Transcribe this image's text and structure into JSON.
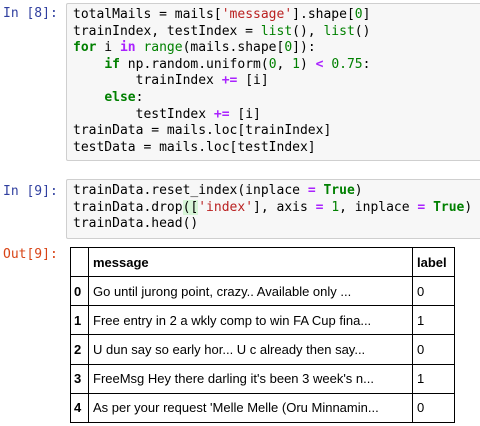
{
  "cells": {
    "in8": {
      "prompt": "In [8]:",
      "lines": [
        [
          {
            "t": "totalMails = mails["
          },
          {
            "t": "'message'",
            "c": "str"
          },
          {
            "t": "].shape["
          },
          {
            "t": "0",
            "c": "num"
          },
          {
            "t": "]"
          }
        ],
        [
          {
            "t": "trainIndex, testIndex = "
          },
          {
            "t": "list",
            "c": "bi"
          },
          {
            "t": "(), "
          },
          {
            "t": "list",
            "c": "bi"
          },
          {
            "t": "()"
          }
        ],
        [
          {
            "t": "for",
            "c": "kw"
          },
          {
            "t": " i "
          },
          {
            "t": "in",
            "c": "op"
          },
          {
            "t": " "
          },
          {
            "t": "range",
            "c": "bi"
          },
          {
            "t": "(mails.shape["
          },
          {
            "t": "0",
            "c": "num"
          },
          {
            "t": "]):"
          }
        ],
        [
          {
            "t": "    "
          },
          {
            "t": "if",
            "c": "kw"
          },
          {
            "t": " np.random.uniform("
          },
          {
            "t": "0",
            "c": "num"
          },
          {
            "t": ", "
          },
          {
            "t": "1",
            "c": "num"
          },
          {
            "t": ") "
          },
          {
            "t": "<",
            "c": "op"
          },
          {
            "t": " "
          },
          {
            "t": "0.75",
            "c": "num"
          },
          {
            "t": ":"
          }
        ],
        [
          {
            "t": "        trainIndex "
          },
          {
            "t": "+=",
            "c": "op"
          },
          {
            "t": " [i]"
          }
        ],
        [
          {
            "t": "    "
          },
          {
            "t": "else",
            "c": "kw"
          },
          {
            "t": ":"
          }
        ],
        [
          {
            "t": "        testIndex "
          },
          {
            "t": "+=",
            "c": "op"
          },
          {
            "t": " [i]"
          }
        ],
        [
          {
            "t": "trainData = mails.loc[trainIndex]"
          }
        ],
        [
          {
            "t": "testData = mails.loc[testIndex]"
          }
        ]
      ]
    },
    "in9": {
      "prompt": "In [9]:",
      "lines": [
        [
          {
            "t": "trainData.reset_index(inplace "
          },
          {
            "t": "=",
            "c": "op"
          },
          {
            "t": " "
          },
          {
            "t": "True",
            "c": "kw"
          },
          {
            "t": ")"
          }
        ],
        [
          {
            "t": "trainData.drop"
          },
          {
            "t": "([",
            "c": "bracket"
          },
          {
            "t": "'index'",
            "c": "str"
          },
          {
            "t": "], axis "
          },
          {
            "t": "=",
            "c": "op"
          },
          {
            "t": " "
          },
          {
            "t": "1",
            "c": "num"
          },
          {
            "t": ", inplace "
          },
          {
            "t": "=",
            "c": "op"
          },
          {
            "t": " "
          },
          {
            "t": "True",
            "c": "kw"
          },
          {
            "t": ")"
          }
        ],
        [
          {
            "t": "trainData.head()"
          }
        ]
      ]
    },
    "out9": {
      "prompt": "Out[9]:",
      "columns": [
        "",
        "message",
        "label"
      ],
      "rows": [
        {
          "index": "0",
          "message": "Go until jurong point, crazy.. Available only ...",
          "label": "0"
        },
        {
          "index": "1",
          "message": "Free entry in 2 a wkly comp to win FA Cup fina...",
          "label": "1"
        },
        {
          "index": "2",
          "message": "U dun say so early hor... U c already then say...",
          "label": "0"
        },
        {
          "index": "3",
          "message": "FreeMsg Hey there darling it's been 3 week's n...",
          "label": "1"
        },
        {
          "index": "4",
          "message": "As per your request 'Melle Melle (Oru Minnamin...",
          "label": "0"
        }
      ]
    }
  }
}
